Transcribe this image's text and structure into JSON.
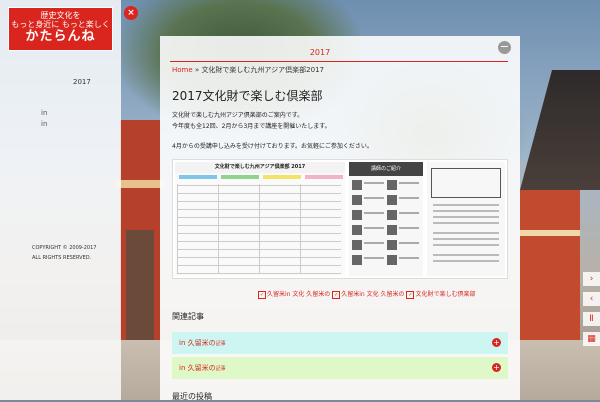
{
  "sidebar": {
    "logo": {
      "line1": "歴史文化を",
      "line2": "もっと身近に もっと楽しく",
      "line3": "かたらんね"
    },
    "year_link": "2017",
    "links": [
      "in",
      "in"
    ],
    "copyright": "COPYRIGHT © 2009-2017",
    "rights": "ALL RIGHTS RESERVED."
  },
  "close_label": "×",
  "panel": {
    "title": "2017",
    "collapse_label": "−",
    "breadcrumb": {
      "home": "Home",
      "separator": "»",
      "current": "文化財で楽しむ九州アジア倶楽部2017"
    },
    "post_title": "2017文化財で楽しむ倶楽部",
    "para1_line1": "文化財で楽しむ九州アジア倶楽部のご案内です。",
    "para1_line2": "今年度も全12回、2月から3月まで講座を開催いたします。",
    "para2": "4月からの受講申し込みを受け付けております。お気軽にご参加ください。",
    "flyer_a_title": "文化財で楽しむ九州アジア倶楽部 2017",
    "flyer_b_title": "講師のご紹介",
    "tags": [
      "久留米in 文化 久留米の",
      "久留米in 文化 久留米の",
      "文化財で楽しむ倶楽部"
    ],
    "section1": "関連記事",
    "accordion": [
      {
        "label": "in 久留米の",
        "sub": "記事"
      },
      {
        "label": "in 久留米の",
        "sub": "記事"
      }
    ],
    "section2": "最近の投稿"
  },
  "right_nav": [
    "›",
    "‹",
    "Ⅱ",
    "▦"
  ],
  "colors": {
    "accent": "#d9251d",
    "accordion1": "#cdf6f3",
    "accordion2": "#dff8c8"
  }
}
